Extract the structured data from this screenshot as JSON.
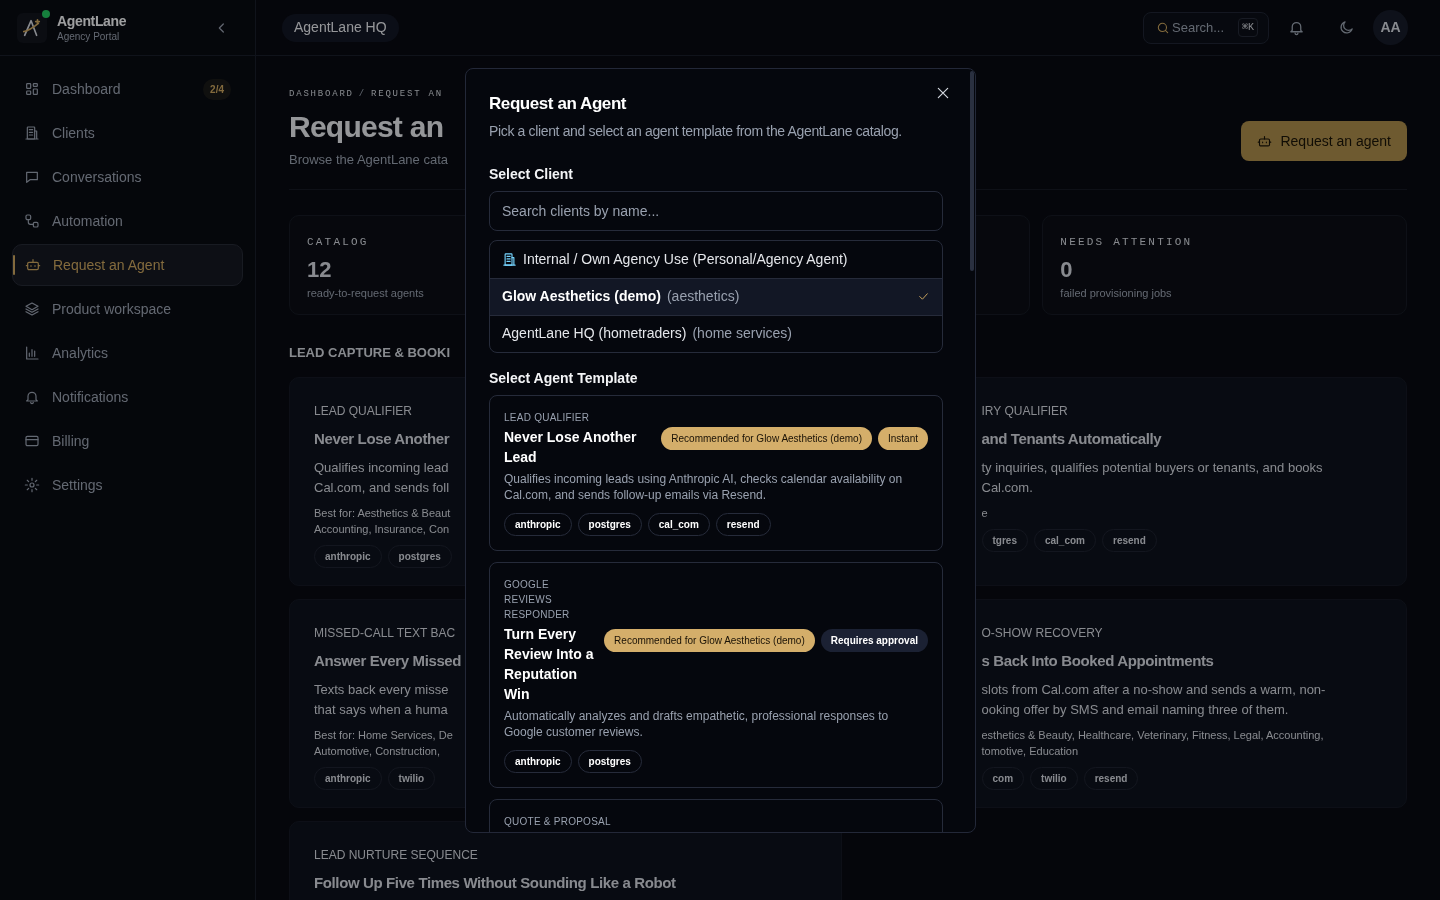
{
  "sidebar": {
    "brand": "AgentLane",
    "subtitle": "Agency Portal",
    "items": [
      {
        "label": "Dashboard",
        "badge": "2/4",
        "selected": false
      },
      {
        "label": "Clients",
        "selected": false
      },
      {
        "label": "Conversations",
        "selected": false
      },
      {
        "label": "Automation",
        "selected": false
      },
      {
        "label": "Request an Agent",
        "selected": true
      },
      {
        "label": "Product workspace",
        "selected": false
      },
      {
        "label": "Analytics",
        "selected": false
      },
      {
        "label": "Notifications",
        "selected": false
      },
      {
        "label": "Billing",
        "selected": false
      },
      {
        "label": "Settings",
        "selected": false
      }
    ]
  },
  "top_bar": {
    "workspace": "AgentLane HQ",
    "search": {
      "placeholder": "Search...",
      "shortcut": "⌘K"
    },
    "avatar": "AA"
  },
  "page": {
    "breadcrumb": [
      "DASHBOARD",
      "/",
      "REQUEST AN"
    ],
    "title": "Request an",
    "subtitle": "Browse the AgentLane cata",
    "primary_button": "Request an agent",
    "stats": [
      {
        "label": "CATALOG",
        "value": "12",
        "caption": "ready-to-request agents"
      },
      {
        "label": "NEEDS ATTENTION",
        "value": "0",
        "caption": "failed provisioning jobs"
      }
    ],
    "section_heading": "LEAD CAPTURE & BOOKI",
    "catalog_cards": [
      {
        "category": "LEAD QUALIFIER",
        "title": "Never Lose Another",
        "description_lines": [
          "Qualifies incoming lead",
          "Cal.com, and sends foll"
        ],
        "best_for_lines": [
          "Best for: Aesthetics & Beaut",
          "Accounting, Insurance, Con"
        ],
        "tags": [
          "anthropic",
          "postgres"
        ]
      },
      {
        "category": "IRY QUALIFIER",
        "title": "and Tenants Automatically",
        "description_lines": [
          "ty inquiries, qualifies potential buyers or tenants, and books",
          "Cal.com."
        ],
        "best_for_lines": [
          "e"
        ],
        "tags": [
          "tgres",
          "cal_com",
          "resend"
        ]
      },
      {
        "category": "MISSED-CALL TEXT BAC",
        "title": "Answer Every Missed",
        "description_lines": [
          "Texts back every misse",
          "that says when a huma"
        ],
        "best_for_lines": [
          "Best for: Home Services, De",
          "Automotive, Construction,"
        ],
        "tags": [
          "anthropic",
          "twilio"
        ]
      },
      {
        "category": "O-SHOW RECOVERY",
        "title": "s Back Into Booked Appointments",
        "description_lines": [
          "slots from Cal.com after a no-show and sends a warm, non-",
          "ooking offer by SMS and email naming three of them."
        ],
        "best_for_lines": [
          "esthetics & Beauty, Healthcare, Veterinary, Fitness, Legal, Accounting,",
          "tomotive, Education"
        ],
        "tags": [
          "com",
          "twilio",
          "resend"
        ]
      },
      {
        "category": "LEAD NURTURE SEQUENCE",
        "title": "Follow Up Five Times Without Sounding Like a Robot"
      }
    ]
  },
  "modal": {
    "title": "Request an Agent",
    "subtitle": "Pick a client and select an agent template from the AgentLane catalog.",
    "client_label": "Select Client",
    "client_search": {
      "placeholder": "Search clients by name..."
    },
    "clients": [
      {
        "name": "Internal / Own Agency Use (Personal/Agency Agent)",
        "kind": "internal",
        "selected": false
      },
      {
        "name": "Glow Aesthetics (demo)",
        "detail": "(aesthetics)",
        "kind": "client",
        "selected": true
      },
      {
        "name": "AgentLane HQ (hometraders)",
        "detail": "(home services)",
        "kind": "client",
        "selected": false
      }
    ],
    "template_label": "Select Agent Template",
    "templates": [
      {
        "category": "LEAD QUALIFIER",
        "title": "Never Lose Another Lead",
        "badges": [
          {
            "text": "Recommended for Glow Aesthetics (demo)",
            "kind": "gold"
          },
          {
            "text": "Instant",
            "kind": "gold"
          }
        ],
        "description": "Qualifies incoming leads using Anthropic AI, checks calendar availability on Cal.com, and sends follow-up emails via Resend.",
        "tags": [
          "anthropic",
          "postgres",
          "cal_com",
          "resend"
        ]
      },
      {
        "category": "GOOGLE REVIEWS RESPONDER",
        "title": "Turn Every Review Into a Reputation Win",
        "badges": [
          {
            "text": "Recommended for Glow Aesthetics (demo)",
            "kind": "gold"
          },
          {
            "text": "Requires approval",
            "kind": "dark"
          }
        ],
        "description": "Automatically analyzes and drafts empathetic, professional responses to Google customer reviews.",
        "tags": [
          "anthropic",
          "postgres"
        ]
      },
      {
        "category": "QUOTE & PROPOSAL"
      }
    ]
  }
}
